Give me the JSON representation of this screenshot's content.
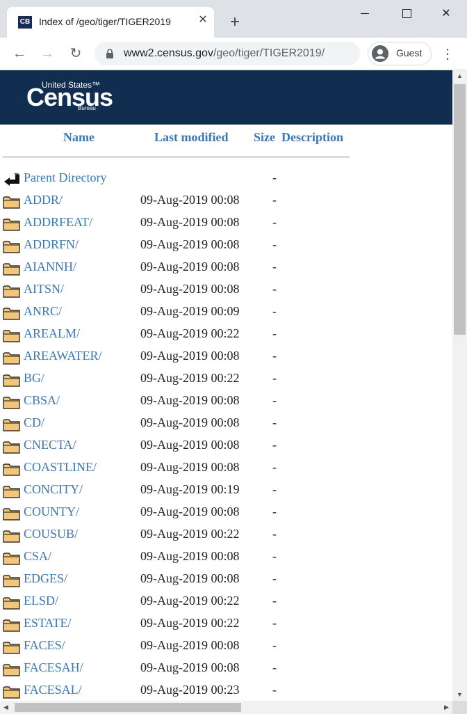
{
  "tab": {
    "favicon_text": "CB",
    "title": "Index of /geo/tiger/TIGER2019",
    "close": "✕",
    "new_tab": "+"
  },
  "window": {
    "close": "✕"
  },
  "toolbar": {
    "back": "←",
    "forward": "→",
    "reload": "↻",
    "url_host": "www2.census.gov",
    "url_path": "/geo/tiger/TIGER2019/",
    "profile_label": "Guest",
    "menu": "⋮"
  },
  "logo": {
    "top_line": "United States™",
    "main": "Census",
    "bottom_line": "Bureau"
  },
  "columns": {
    "name": "Name",
    "last_modified": "Last modified",
    "size": "Size",
    "description": "Description"
  },
  "parent": {
    "name": "Parent Directory",
    "size": "-"
  },
  "entries": [
    {
      "name": "ADDR/",
      "date": "09-Aug-2019 00:08",
      "size": "-"
    },
    {
      "name": "ADDRFEAT/",
      "date": "09-Aug-2019 00:08",
      "size": "-"
    },
    {
      "name": "ADDRFN/",
      "date": "09-Aug-2019 00:08",
      "size": "-"
    },
    {
      "name": "AIANNH/",
      "date": "09-Aug-2019 00:08",
      "size": "-"
    },
    {
      "name": "AITSN/",
      "date": "09-Aug-2019 00:08",
      "size": "-"
    },
    {
      "name": "ANRC/",
      "date": "09-Aug-2019 00:09",
      "size": "-"
    },
    {
      "name": "AREALM/",
      "date": "09-Aug-2019 00:22",
      "size": "-"
    },
    {
      "name": "AREAWATER/",
      "date": "09-Aug-2019 00:08",
      "size": "-"
    },
    {
      "name": "BG/",
      "date": "09-Aug-2019 00:22",
      "size": "-"
    },
    {
      "name": "CBSA/",
      "date": "09-Aug-2019 00:08",
      "size": "-"
    },
    {
      "name": "CD/",
      "date": "09-Aug-2019 00:08",
      "size": "-"
    },
    {
      "name": "CNECTA/",
      "date": "09-Aug-2019 00:08",
      "size": "-"
    },
    {
      "name": "COASTLINE/",
      "date": "09-Aug-2019 00:08",
      "size": "-"
    },
    {
      "name": "CONCITY/",
      "date": "09-Aug-2019 00:19",
      "size": "-"
    },
    {
      "name": "COUNTY/",
      "date": "09-Aug-2019 00:08",
      "size": "-"
    },
    {
      "name": "COUSUB/",
      "date": "09-Aug-2019 00:22",
      "size": "-"
    },
    {
      "name": "CSA/",
      "date": "09-Aug-2019 00:08",
      "size": "-"
    },
    {
      "name": "EDGES/",
      "date": "09-Aug-2019 00:08",
      "size": "-"
    },
    {
      "name": "ELSD/",
      "date": "09-Aug-2019 00:22",
      "size": "-"
    },
    {
      "name": "ESTATE/",
      "date": "09-Aug-2019 00:22",
      "size": "-"
    },
    {
      "name": "FACES/",
      "date": "09-Aug-2019 00:08",
      "size": "-"
    },
    {
      "name": "FACESAH/",
      "date": "09-Aug-2019 00:08",
      "size": "-"
    },
    {
      "name": "FACESAL/",
      "date": "09-Aug-2019 00:23",
      "size": "-"
    }
  ],
  "colors": {
    "header_bg": "#112e51",
    "link": "#3b78b5",
    "folder_fill": "#f3c77b"
  }
}
